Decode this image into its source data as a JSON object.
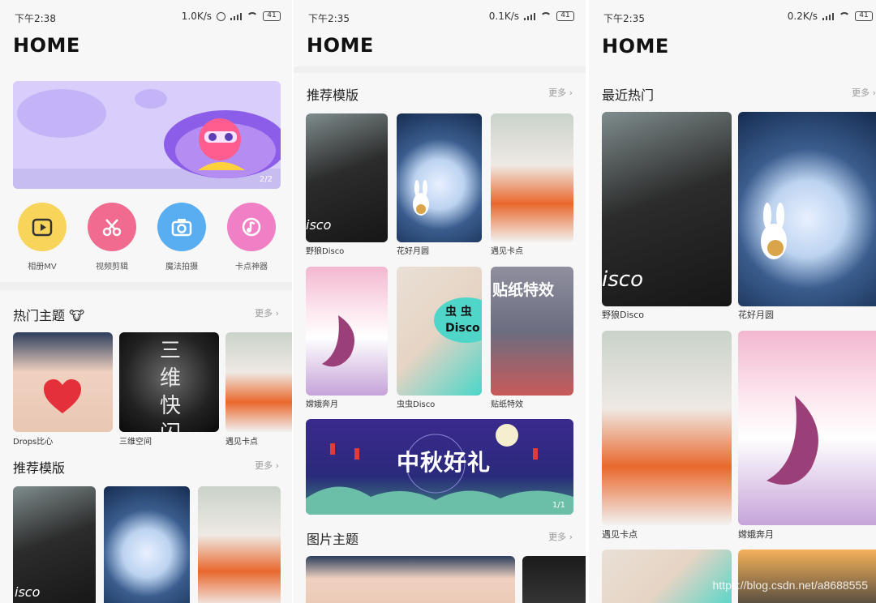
{
  "screens": [
    {
      "status": {
        "time": "下午2:38",
        "speed": "1.0K/s",
        "battery": "41"
      },
      "title": "HOME",
      "banner": {
        "pager": "2/2"
      },
      "quick": [
        {
          "label": "相册MV",
          "icon": "play-icon",
          "color": "#f9d45a"
        },
        {
          "label": "视频剪辑",
          "icon": "scissors-icon",
          "color": "#f06b8e"
        },
        {
          "label": "魔法拍摄",
          "icon": "camera-icon",
          "color": "#58aef0"
        },
        {
          "label": "卡点神器",
          "icon": "music-icon",
          "color": "#f07fc6"
        }
      ],
      "hot": {
        "title": "热门主题 🐮",
        "more": "更多 ›",
        "items": [
          {
            "label": "Drops比心"
          },
          {
            "label": "三维空间"
          },
          {
            "label": "遇见卡点"
          }
        ]
      },
      "rec": {
        "title": "推荐模版",
        "more": "更多 ›"
      },
      "cover_text": {
        "sanwei": "三维快闪"
      }
    },
    {
      "status": {
        "time": "下午2:35",
        "speed": "0.1K/s",
        "battery": "41"
      },
      "title": "HOME",
      "rec": {
        "title": "推荐模版",
        "more": "更多 ›",
        "items": [
          {
            "label": "野狼Disco"
          },
          {
            "label": "花好月圆"
          },
          {
            "label": "遇见卡点"
          },
          {
            "label": "嫦娥奔月"
          },
          {
            "label": "虫虫Disco"
          },
          {
            "label": "贴纸特效"
          }
        ]
      },
      "banner": {
        "text": "中秋好礼",
        "pager": "1/1"
      },
      "pic": {
        "title": "图片主题",
        "more": "更多 ›"
      },
      "cover_text": {
        "sticker": "贴纸特效",
        "bug": "虫 虫 Disco",
        "disco": "isco"
      }
    },
    {
      "status": {
        "time": "下午2:35",
        "speed": "0.2K/s",
        "battery": "41"
      },
      "title": "HOME",
      "recent": {
        "title": "最近热门",
        "more": "更多 ›",
        "items": [
          {
            "label": "野狼Disco"
          },
          {
            "label": "花好月圆"
          },
          {
            "label": "遇见卡点"
          },
          {
            "label": "嫦娥奔月"
          }
        ]
      },
      "watermark": "https://blog.csdn.net/a8688555",
      "cover_text": {
        "disco": "isco"
      }
    }
  ]
}
